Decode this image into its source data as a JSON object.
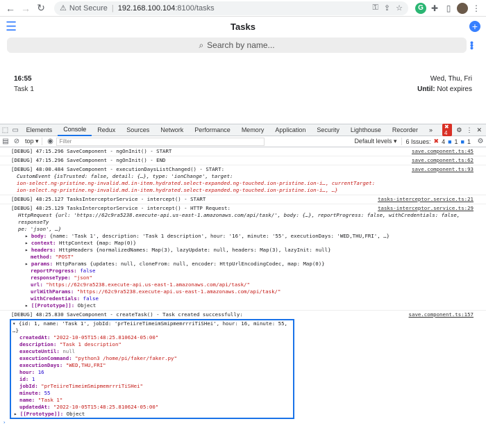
{
  "browser": {
    "url_security": "Not Secure",
    "url_host": "192.168.100.104",
    "url_path": ":8100/tasks"
  },
  "app": {
    "title": "Tasks",
    "search_placeholder": "Search by name...",
    "task": {
      "time": "16:55",
      "name": "Task 1",
      "days": "Wed, Thu, Fri",
      "until_label": "Until:",
      "until_value": "Not expires"
    }
  },
  "devtools": {
    "tabs": [
      "Elements",
      "Console",
      "Redux",
      "Sources",
      "Network",
      "Performance",
      "Memory",
      "Application",
      "Security",
      "Lighthouse",
      "Recorder"
    ],
    "active_tab": "Console",
    "error_badge": "4",
    "context": "top",
    "filter_placeholder": "Filter",
    "levels": "Default levels",
    "issues_label": "6 Issues:",
    "issues_err": "4",
    "issues_info": "1",
    "issues_other": "1"
  },
  "console": {
    "logs": [
      {
        "text": "[DEBUG] 47:15.296 SaveComponent - ngOnInit() - START",
        "src": "save.component.ts:45"
      },
      {
        "text": "[DEBUG] 47:15.296 SaveComponent - ngOnInit() - END",
        "src": "save.component.ts:62"
      },
      {
        "text": "[DEBUG] 48:00.484 SaveComponent - executionDaysListChanged() - START:",
        "src": "save.component.ts:93"
      },
      {
        "text": "[DEBUG] 48:25.127 TasksInterceptorService - intercept() - START",
        "src": "tasks-interceptor.service.ts:21"
      },
      {
        "text": "[DEBUG] 48:25.129 TasksInterceptorService - intercept() - HTTP Request:",
        "src": "tasks-interceptor.service.ts:29"
      },
      {
        "text": "[DEBUG] 48:25.830 SaveComponent - createTask() - Task created successfully:",
        "src": "save.component.ts:157"
      }
    ],
    "custom_event_line1": "CustomEvent {isTrusted: false, detail: {…}, type: 'ionChange', target:",
    "custom_event_line2": "ion-select.ng-pristine.ng-invalid.md.in-item.hydrated.select-expanded.ng-touched.ion-pristine.ion-i…, currentTarget:",
    "custom_event_line3": "ion-select.ng-pristine.ng-invalid.md.in-item.hydrated.select-expanded.ng-touched.ion-pristine.ion-i…, …}",
    "http_line1": "HttpRequest {url: 'https://62c9ra5238.execute-api.us-east-1.amazonaws.com/api/task/', body: {…}, reportProgress: false, withCredentials: false, responseTy",
    "http_line2": "pe: 'json', …}",
    "http_props": [
      {
        "k": "body:",
        "v": "{name: 'Task 1', description: 'Task 1 description', hour: '16', minute: '55', executionDays: 'WED,THU,FRI', …}",
        "ex": true
      },
      {
        "k": "context:",
        "v": "HttpContext {map: Map(0)}",
        "ex": true
      },
      {
        "k": "headers:",
        "v": "HttpHeaders {normalizedNames: Map(3), lazyUpdate: null, headers: Map(3), lazyInit: null}",
        "ex": true
      },
      {
        "k": "method:",
        "v": "\"POST\"",
        "ex": false
      },
      {
        "k": "params:",
        "v": "HttpParams {updates: null, cloneFrom: null, encoder: HttpUrlEncodingCodec, map: Map(0)}",
        "ex": true
      },
      {
        "k": "reportProgress:",
        "v": "false",
        "ex": false
      },
      {
        "k": "responseType:",
        "v": "\"json\"",
        "ex": false
      },
      {
        "k": "url:",
        "v": "\"https://62c9ra5238.execute-api.us-east-1.amazonaws.com/api/task/\"",
        "ex": false
      },
      {
        "k": "urlWithParams:",
        "v": "\"https://62c9ra5238.execute-api.us-east-1.amazonaws.com/api/task/\"",
        "ex": false
      },
      {
        "k": "withCredentials:",
        "v": "false",
        "ex": false
      },
      {
        "k": "[[Prototype]]:",
        "v": "Object",
        "ex": true
      }
    ],
    "task_summary": "▾ {id: 1, name: 'Task 1', jobId: 'prTeiireTimeimSmipmemrrriTiSHei', hour: 16, minute: 55, …}",
    "task_props": [
      {
        "k": "createdAt:",
        "v": "\"2022-10-05T15:48:25.810624-05:00\""
      },
      {
        "k": "description:",
        "v": "\"Task 1 description\""
      },
      {
        "k": "executeUntil:",
        "v": "null"
      },
      {
        "k": "executionCommand:",
        "v": "\"python3 /home/pi/faker/faker.py\""
      },
      {
        "k": "executionDays:",
        "v": "\"WED,THU,FRI\""
      },
      {
        "k": "hour:",
        "v": "16"
      },
      {
        "k": "id:",
        "v": "1"
      },
      {
        "k": "jobId:",
        "v": "\"prTeiireTimeimSmipmemrrriTiSHei\""
      },
      {
        "k": "minute:",
        "v": "55"
      },
      {
        "k": "name:",
        "v": "\"Task 1\""
      },
      {
        "k": "updatedAt:",
        "v": "\"2022-10-05T15:48:25.810624-05:00\""
      },
      {
        "k": "[[Prototype]]:",
        "v": "Object"
      }
    ],
    "prompt": "›"
  }
}
